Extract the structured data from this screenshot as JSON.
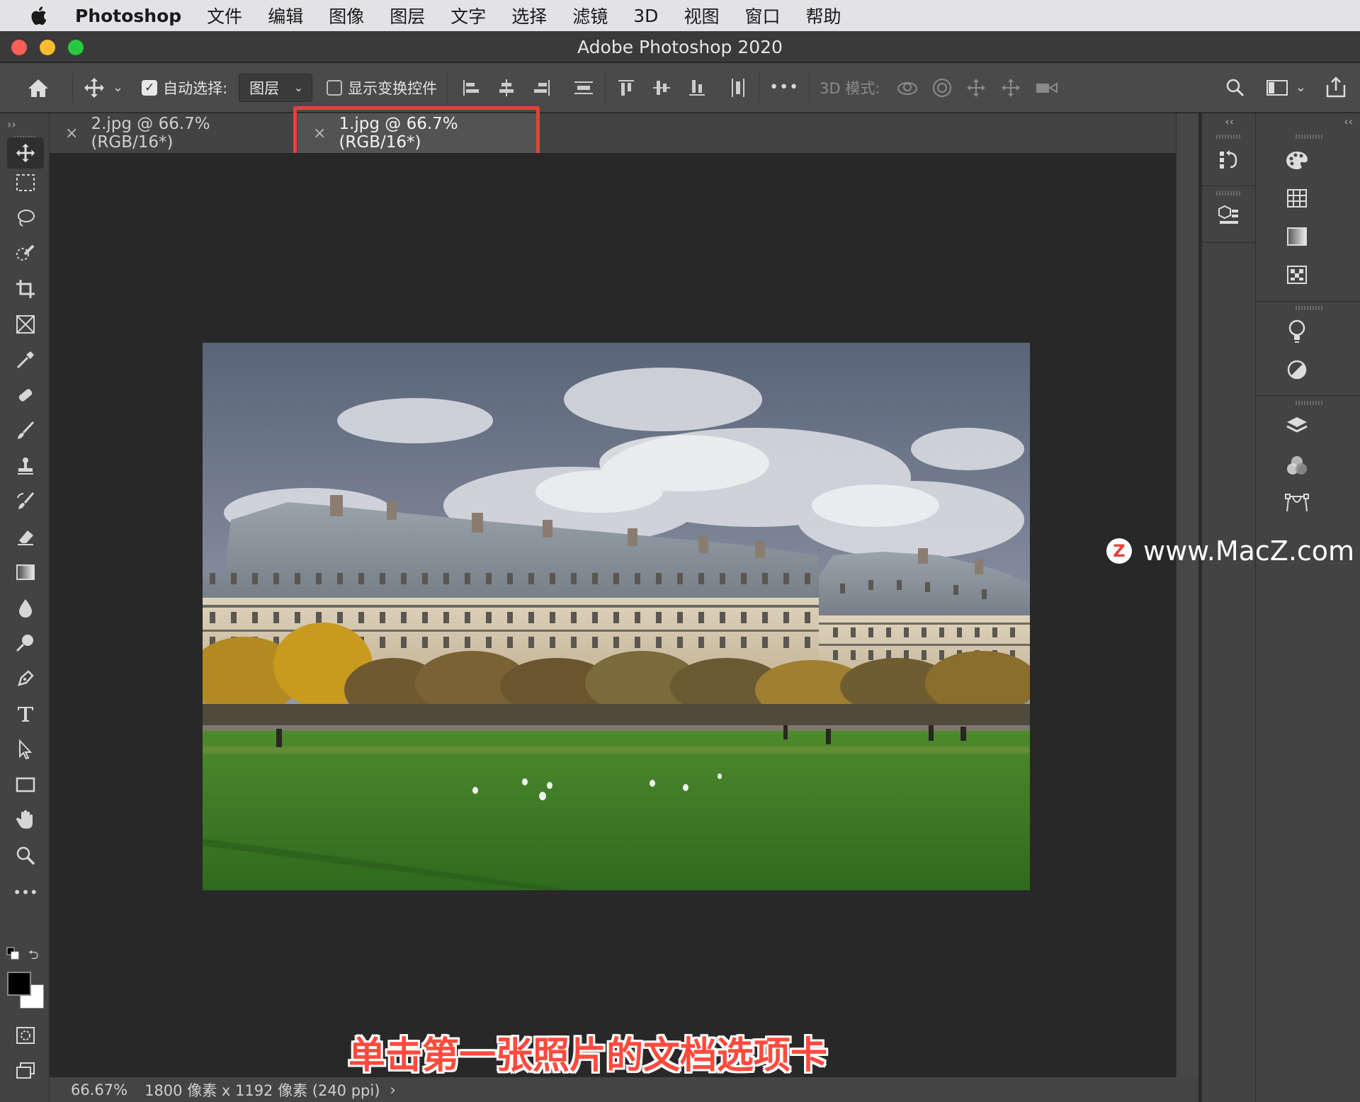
{
  "menubar": {
    "app_name": "Photoshop",
    "items": [
      "文件",
      "编辑",
      "图像",
      "图层",
      "文字",
      "选择",
      "滤镜",
      "3D",
      "视图",
      "窗口",
      "帮助"
    ]
  },
  "window": {
    "title": "Adobe Photoshop 2020"
  },
  "options_bar": {
    "auto_select_label": "自动选择:",
    "auto_select_checked": true,
    "auto_select_target": "图层",
    "show_transform_label": "显示变换控件",
    "show_transform_checked": false,
    "mode_3d_label": "3D 模式:",
    "more_label": "•••"
  },
  "tabs": [
    {
      "label": "2.jpg @ 66.7%(RGB/16*)",
      "active": false
    },
    {
      "label": "1.jpg @ 66.7%(RGB/16*)",
      "active": true
    }
  ],
  "status": {
    "zoom": "66.67%",
    "doc_info": "1800 像素 x 1192 像素 (240 ppi)",
    "arrow": "›"
  },
  "watermark": {
    "logo": "Z",
    "text": "www.MacZ.com"
  },
  "caption": "单击第一张照片的文档选项卡",
  "colors": {
    "highlight": "#e8403a",
    "caption": "#ff4a3d"
  }
}
